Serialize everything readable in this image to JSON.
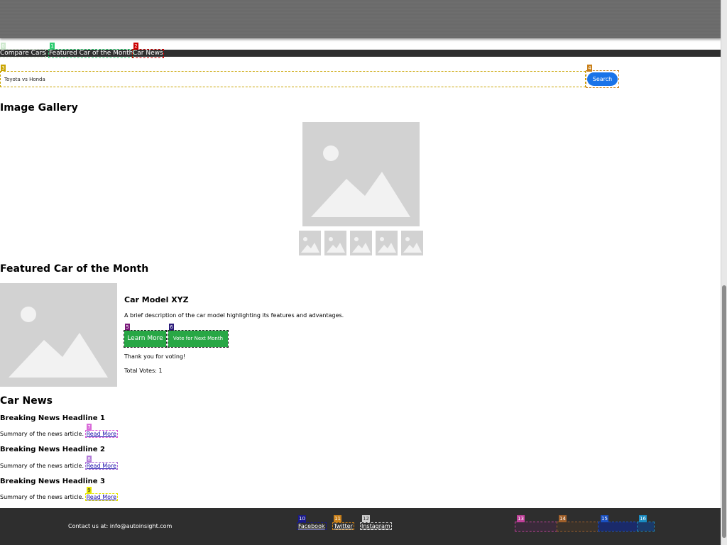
{
  "nav": {
    "items": [
      {
        "label": "Compare Cars",
        "tag": "0"
      },
      {
        "label": "Featured Car of the Month",
        "tag": "1"
      },
      {
        "label": "Car News",
        "tag": "2"
      }
    ]
  },
  "search": {
    "value": "Toyota vs Honda",
    "button_label": "Search",
    "input_tag": "3",
    "button_tag": "4"
  },
  "gallery": {
    "heading": "Image Gallery"
  },
  "featured": {
    "heading": "Featured Car of the Month",
    "car_title": "Car Model XYZ",
    "description": "A brief description of the car model highlighting its features and advantages.",
    "learn_more": "Learn More",
    "vote": "Vote for Next Month",
    "learn_tag": "5",
    "vote_tag": "6",
    "vote_message": "Thank you for voting!",
    "total_votes": "Total Votes: 1"
  },
  "news": {
    "heading": "Car News",
    "articles": [
      {
        "headline": "Breaking News Headline 1",
        "summary": "Summary of the news article.",
        "link": "Read More",
        "tag": "7"
      },
      {
        "headline": "Breaking News Headline 2",
        "summary": "Summary of the news article.",
        "link": "Read More",
        "tag": "8"
      },
      {
        "headline": "Breaking News Headline 3",
        "summary": "Summary of the news article.",
        "link": "Read More",
        "tag": "9"
      }
    ]
  },
  "footer": {
    "contact": "Contact us at: info@autoinsight.com",
    "social": [
      {
        "label": "Facebook",
        "tag": "10"
      },
      {
        "label": "Twitter",
        "tag": "11"
      },
      {
        "label": "Instagram",
        "tag": "12"
      }
    ],
    "extra_tags": [
      "13",
      "14",
      "15",
      "16"
    ]
  },
  "colors": {
    "nav_bg": "#2f2f2f",
    "search_button": "#1a73e8",
    "action_button": "#28a745",
    "footer_bg": "#2e2e2e",
    "link": "#1a0dab"
  }
}
